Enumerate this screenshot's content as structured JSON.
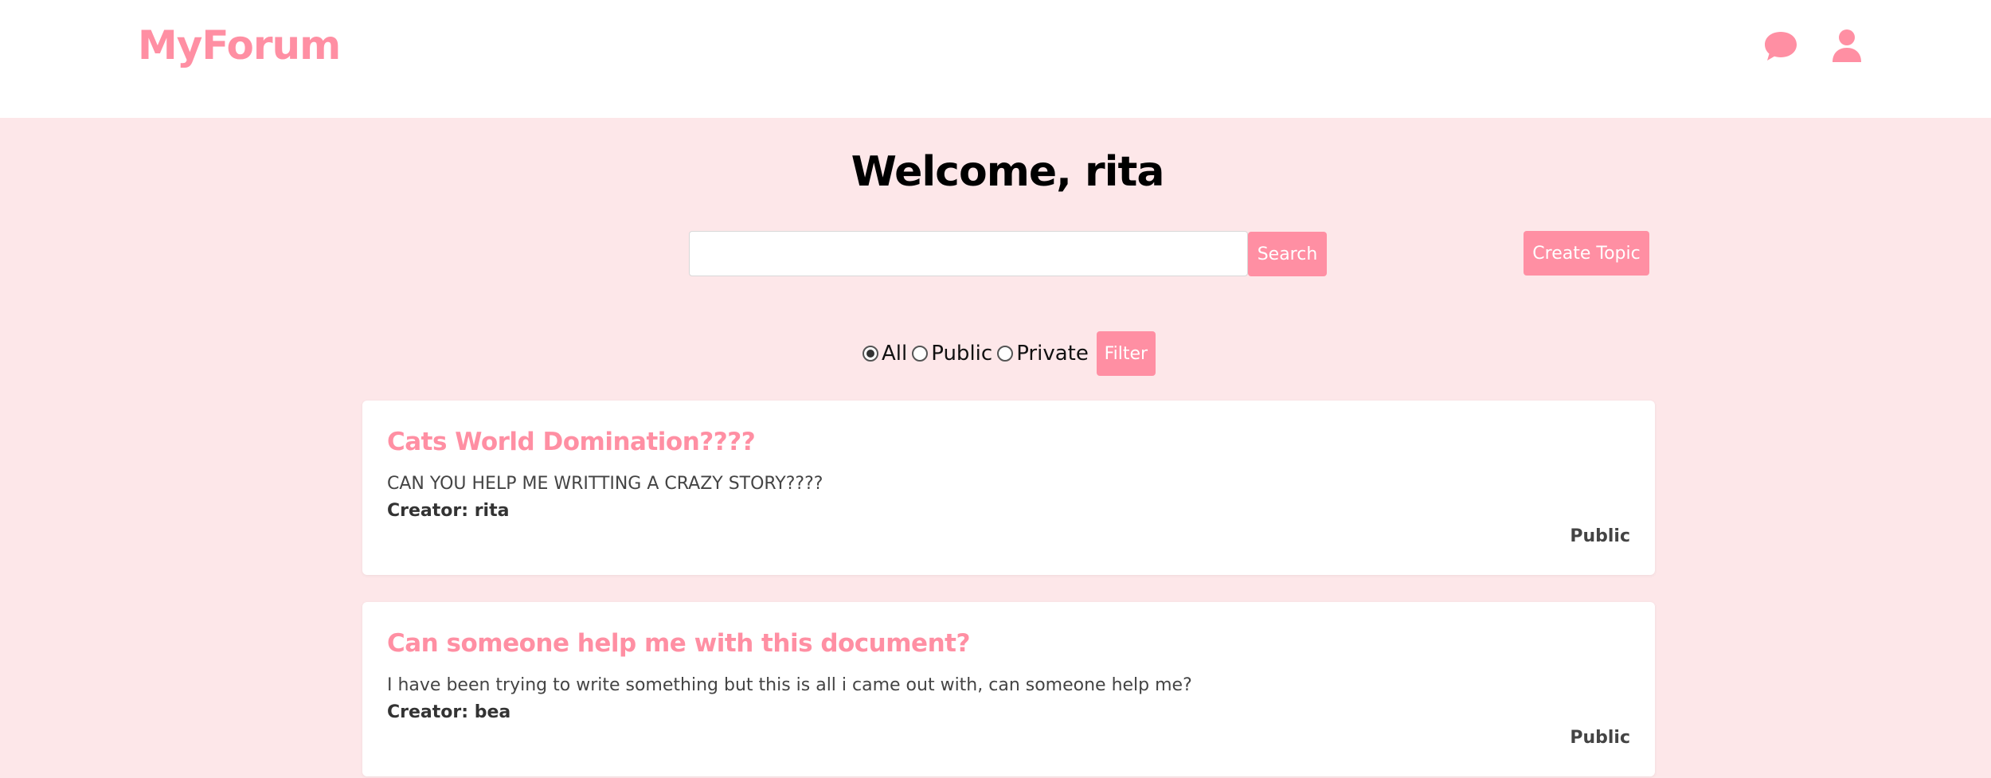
{
  "header": {
    "logo": "MyForum",
    "chat_icon": "chat-bubble-icon",
    "user_icon": "user-icon",
    "accent_color": "#ff8fa3"
  },
  "main": {
    "background_color": "#fde7e9",
    "welcome": "Welcome, rita",
    "search": {
      "value": "",
      "placeholder": "",
      "button_label": "Search"
    },
    "create_topic_label": "Create Topic",
    "filter": {
      "options": [
        {
          "label": "All",
          "checked": true
        },
        {
          "label": "Public",
          "checked": false
        },
        {
          "label": "Private",
          "checked": false
        }
      ],
      "button_label": "Filter"
    },
    "topics": [
      {
        "title": "Cats World Domination????",
        "description": "CAN YOU HELP ME WRITTING A CRAZY STORY????",
        "creator": "Creator: rita",
        "visibility": "Public"
      },
      {
        "title": "Can someone help me with this document?",
        "description": "I have been trying to write something but this is all i came out with, can someone help me?",
        "creator": "Creator: bea",
        "visibility": "Public"
      }
    ]
  }
}
